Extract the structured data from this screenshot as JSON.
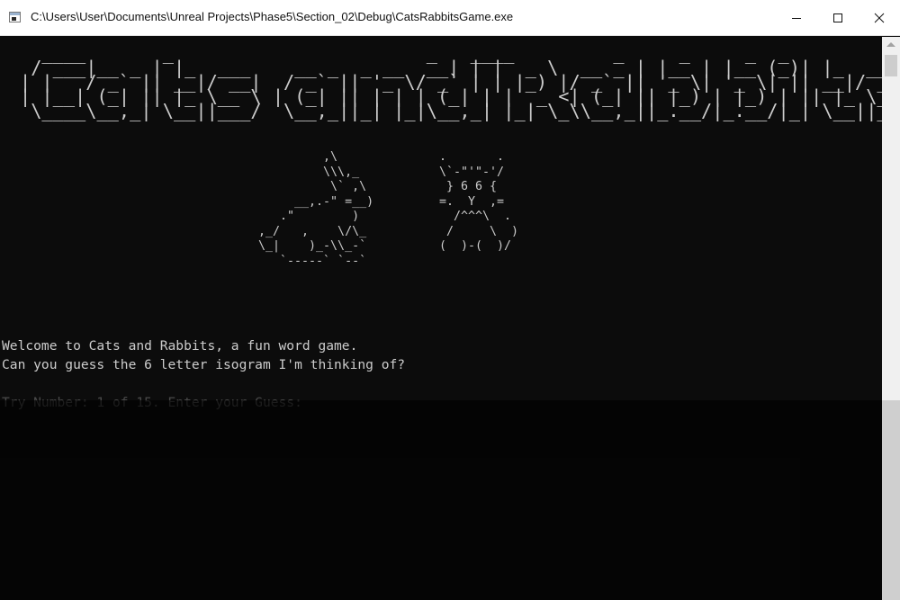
{
  "window": {
    "title": "C:\\Users\\User\\Documents\\Unreal Projects\\Phase5\\Section_02\\Debug\\CatsRabbitsGame.exe"
  },
  "console": {
    "title_art": "  ____       _                       _   ____         _     _     _  _        \n / ___|__ _ | |_  ___    __ _  _ __  __| | |  _ \\  __ _ | |__ | |__ (_)| |_  ___ \n| |   / _` || __|/ __|  / _` || '_ \\/ _` | | |_) |/ _` || '_ \\| '_ \\| || __|/ __|\n| |__| (_| || |_ \\__ \\ | (_| || | | | (_| | |  _ <| (_| || |_) | |_) | || |_ \\__ \\\n \\____\\__,_| \\__||___/  \\__,_||_| |_|\\__,_| |_| \\_\\\\__,_||_.__/|_.__/|_| \\__||___/",
    "rabbit_art": "         ,\\\n         \\\\\\,_\n          \\` ,\\\n     __,.-\" =__)\n   .\"        )\n,_/   ,    \\/\\_\n\\_|    )_-\\\\_-`\n   `-----` `--`",
    "cat_art": ".       .\n\\`-\"'\"-'/\n } 6 6 {\n=.  Y  ,=\n  /^^^\\  .\n /     \\  )\n(  )-(  )/",
    "welcome_line": "Welcome to Cats and Rabbits, a fun word game.",
    "question_line": "Can you guess the 6 letter isogram I'm thinking of?",
    "prompt_line": "Try Number: 1 of 15. Enter your Guess:"
  },
  "colors": {
    "console_background": "#0c0c0c",
    "console_text": "#cccccc",
    "titlebar_background": "#ffffff"
  }
}
